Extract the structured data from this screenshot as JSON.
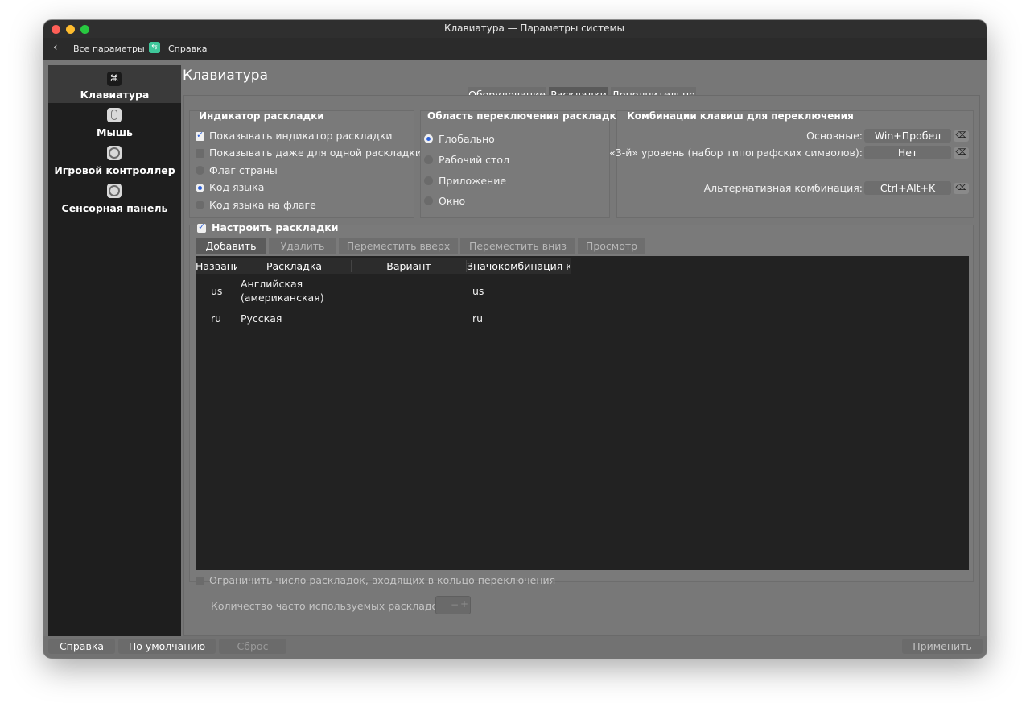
{
  "window": {
    "title": "Клавиатура — Параметры системы"
  },
  "toolbar": {
    "back_label": "Все параметры",
    "help_label": "Справка"
  },
  "sidebar": {
    "items": [
      {
        "label": "Клавиатура",
        "icon": "keyboard-icon"
      },
      {
        "label": "Мышь",
        "icon": "mouse-icon"
      },
      {
        "label": "Игровой контроллер",
        "icon": "gamepad-icon"
      },
      {
        "label": "Сенсорная панель",
        "icon": "touchpad-icon"
      }
    ]
  },
  "page": {
    "title": "Клавиатура",
    "tabs": [
      "Оборудование",
      "Раскладки",
      "Дополнительно"
    ]
  },
  "indicator": {
    "title": "Индикатор раскладки",
    "show_indicator": "Показывать индикатор раскладки",
    "show_single": "Показывать даже для одной раскладки",
    "flag": "Флаг страны",
    "code": "Код языка",
    "code_on_flag": "Код языка на флаге"
  },
  "scope": {
    "title": "Область переключения раскладки",
    "global": "Глобально",
    "desktop": "Рабочий стол",
    "app": "Приложение",
    "window": "Окно"
  },
  "shortcuts": {
    "title": "Комбинации клавиш для переключения",
    "main_label": "Основные:",
    "main_value": "Win+Пробел",
    "third_label": "«3-й» уровень (набор типографских символов):",
    "third_value": "Нет",
    "alt_label": "Альтернативная комбинация:",
    "alt_value": "Ctrl+Alt+K",
    "clear_icon": "backspace-icon"
  },
  "layouts": {
    "configure_label": "Настроить раскладки",
    "buttons": [
      "Добавить",
      "Удалить",
      "Переместить вверх",
      "Переместить вниз",
      "Просмотр"
    ],
    "columns": [
      "Названи",
      "Раскладка",
      "Вариант",
      "Значокомбинация клав"
    ],
    "rows": [
      {
        "code": "us",
        "layout_line1": "Английская",
        "layout_line2": "(американская)",
        "variant": "",
        "shortcut": "us"
      },
      {
        "code": "ru",
        "layout_line1": "Русская",
        "layout_line2": "",
        "variant": "",
        "shortcut": "ru"
      }
    ],
    "limit_label": "Ограничить число раскладок, входящих в кольцо переключения",
    "count_label": "Количество часто используемых раскладок:",
    "count_minus": "−",
    "count_plus": "+"
  },
  "footer": {
    "help": "Справка",
    "defaults": "По умолчанию",
    "reset": "Сброс",
    "apply": "Применить"
  },
  "colors": {
    "close": "#ff5f57",
    "minimize": "#febc2e",
    "maximize": "#28c840",
    "accent": "#2b5fd8",
    "help_icon": "#3ec79a"
  }
}
